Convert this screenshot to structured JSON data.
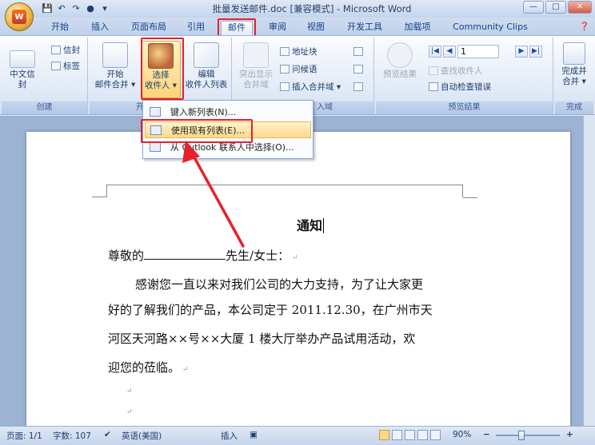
{
  "window": {
    "title": "批量发送邮件.doc [兼容模式] - Microsoft Word",
    "controls": [
      "—",
      "□",
      "✕"
    ]
  },
  "quick_access": [
    "💾",
    "↶",
    "↷",
    "●",
    "▾"
  ],
  "tabs": [
    "开始",
    "插入",
    "页面布局",
    "引用",
    "邮件",
    "审阅",
    "视图",
    "开发工具",
    "加载项",
    "Community Clips"
  ],
  "active_tab": "邮件",
  "ribbon": {
    "create": {
      "label": "创建",
      "chinese_envelope": "中文信封",
      "envelope": "信封",
      "labels": "标签"
    },
    "start_mail_merge": {
      "label": "开",
      "start_line1": "开始",
      "start_line2": "邮件合并 ▾",
      "select_line1": "选择",
      "select_line2": "收件人 ▾",
      "edit_line1": "编辑",
      "edit_line2": "收件人列表"
    },
    "write_insert": {
      "label": "入域",
      "highlight_line1": "突出显示",
      "highlight_line2": "合并域",
      "address_block": "地址块",
      "greeting_line": "问候语",
      "insert_merge_field": "插入合并域 ▾"
    },
    "preview": {
      "label": "预览结果",
      "preview_results": "预览结果",
      "record_number": "1",
      "find_recipient": "查找收件人",
      "auto_check": "自动检查错误"
    },
    "finish": {
      "label": "完成",
      "finish_line1": "完成并",
      "finish_line2": "合并 ▾"
    }
  },
  "dropdown": {
    "items": [
      "键入新列表(N)...",
      "使用现有列表(E)...",
      "从 Outlook 联系人中选择(O)..."
    ],
    "highlighted_index": 1
  },
  "document": {
    "title": "通知",
    "salutation_prefix": "尊敬的",
    "salutation_suffix": "先生/女士：",
    "body_line1": "感谢您一直以来对我们公司的大力支持，为了让大家更",
    "body_line2": "好的了解我们的产品，本公司定于 2011.12.30，在广州市天",
    "body_line3": "河区天河路××号××大厦 1 楼大厅举办产品试用活动，欢",
    "body_line4": "迎您的莅临。",
    "paragraph_mark": "↵"
  },
  "status_bar": {
    "page": "页面: 1/1",
    "words": "字数: 107",
    "language": "英语(美国)",
    "mode": "插入",
    "zoom": "90%",
    "zoom_minus": "−",
    "zoom_plus": "+"
  },
  "colors": {
    "highlight_red": "#e8202a",
    "ribbon_blue": "#15428b"
  }
}
